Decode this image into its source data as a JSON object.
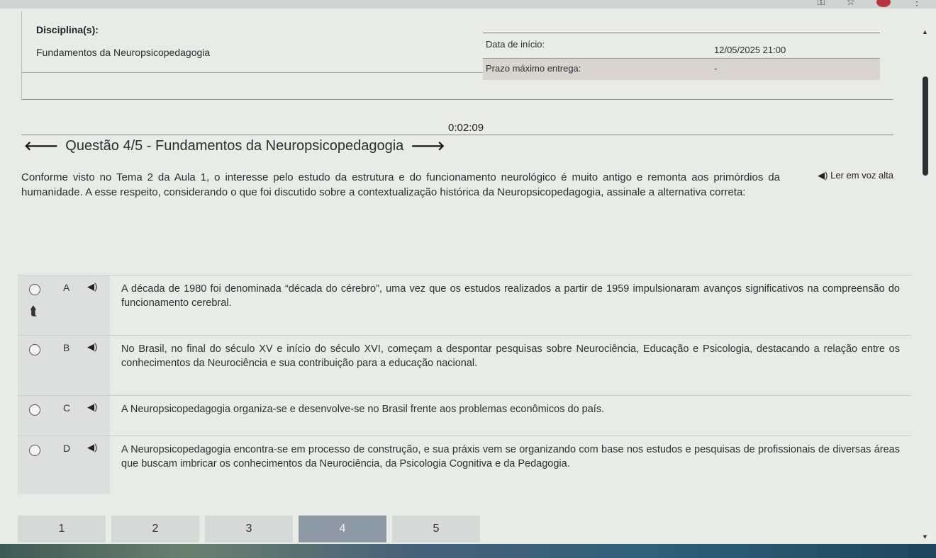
{
  "browser": {
    "icons": [
      "key-icon",
      "star-icon",
      "profile-avatar",
      "menu-dots-icon"
    ]
  },
  "info": {
    "discipline_label": "Disciplina(s):",
    "discipline_value": "Fundamentos da Neuropsicopedagogia",
    "start_label": "Data de início:",
    "start_value": "12/05/2025 21:00",
    "deadline_label": "Prazo máximo entrega:",
    "deadline_value": "-"
  },
  "timer": "0:02:09",
  "question": {
    "title": "Questão 4/5 - Fundamentos da Neuropsicopedagogia",
    "read_aloud": "Ler em voz alta",
    "text": "Conforme visto no Tema 2 da Aula 1, o interesse pelo estudo da estrutura e do funcionamento neurológico é muito antigo e remonta aos primórdios da humanidade. A esse respeito, considerando o que foi discutido sobre a contextualização histórica da Neuropsicopedagogia, assinale a alternativa correta:"
  },
  "options": [
    {
      "letter": "A",
      "text": "A década de 1980 foi denominada “década do cérebro”, uma vez que os estudos realizados a partir de 1959 impulsionaram avanços significativos na compreensão do funcionamento cerebral."
    },
    {
      "letter": "B",
      "text": "No Brasil, no final do século XV e início do século XVI, começam a despontar pesquisas sobre Neurociência, Educação e Psicologia, destacando a relação entre os conhecimentos da Neurociência e sua contribuição para a educação nacional."
    },
    {
      "letter": "C",
      "text": "A Neuropsicopedagogia organiza-se e desenvolve-se no Brasil frente aos problemas econômicos do país."
    },
    {
      "letter": "D",
      "text": "A Neuropsicopedagogia encontra-se em processo de construção, e sua práxis vem se organizando com base nos estudos e pesquisas de profissionais de diversas áreas que buscam imbricar os conhecimentos da Neurociência, da Psicologia Cognitiva e da Pedagogia."
    }
  ],
  "pagination": {
    "pages": [
      "1",
      "2",
      "3",
      "4",
      "5"
    ],
    "current": "4"
  }
}
